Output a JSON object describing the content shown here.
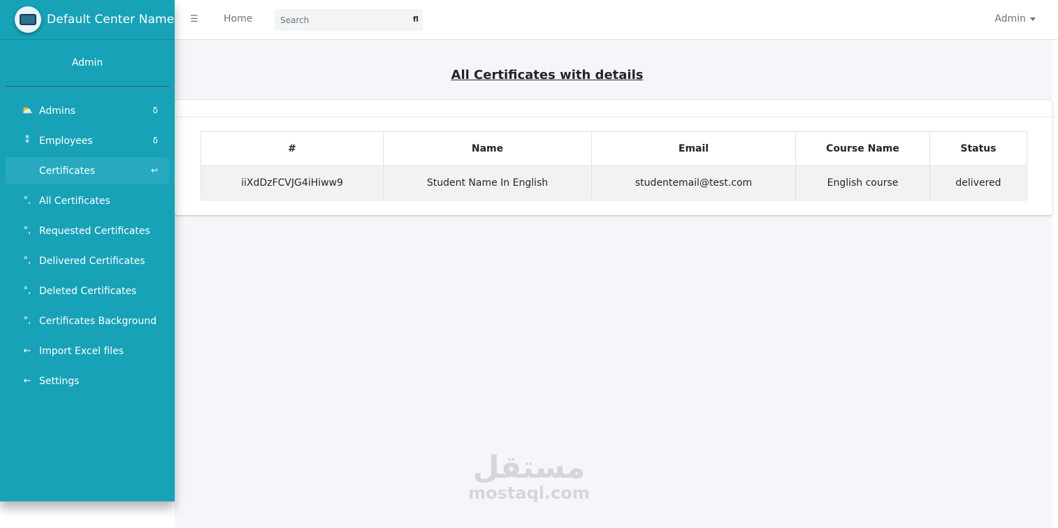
{
  "brand": {
    "name": "Default Center Name"
  },
  "user": {
    "name": "Admin"
  },
  "sidebar": {
    "items": [
      {
        "label": "Admins",
        "icon": "gauge-icon",
        "glyph": "⛅",
        "caret": "δ",
        "active": false
      },
      {
        "label": "Employees",
        "icon": "users-icon",
        "glyph": "⁑",
        "caret": "δ",
        "active": false
      },
      {
        "label": "Certificates",
        "icon": "certificate-icon",
        "glyph": "",
        "caret": "↩",
        "active": true
      },
      {
        "label": "All Certificates",
        "icon": "circle-icon",
        "glyph": "°,",
        "caret": "",
        "active": false
      },
      {
        "label": "Requested Certificates",
        "icon": "circle-icon",
        "glyph": "°,",
        "caret": "",
        "active": false
      },
      {
        "label": "Delivered Certificates",
        "icon": "circle-icon",
        "glyph": "°,",
        "caret": "",
        "active": false
      },
      {
        "label": "Deleted Certificates",
        "icon": "circle-icon",
        "glyph": "°,",
        "caret": "",
        "active": false
      },
      {
        "label": "Certificates Background",
        "icon": "circle-icon",
        "glyph": "°,",
        "caret": "",
        "active": false
      },
      {
        "label": "Import Excel files",
        "icon": "arrow-left-icon",
        "glyph": "←",
        "caret": "",
        "active": false
      },
      {
        "label": "Settings",
        "icon": "arrow-left-icon",
        "glyph": "←",
        "caret": "",
        "active": false
      }
    ]
  },
  "topbar": {
    "menu_glyph": "☰",
    "home_label": "Home",
    "search_placeholder": "Search",
    "search_glyph": "fl",
    "user_menu_label": "Admin"
  },
  "page": {
    "title": "All Certificates with details"
  },
  "table": {
    "headers": [
      "#",
      "Name",
      "Email",
      "Course Name",
      "Status"
    ],
    "rows": [
      [
        "iiXdDzFCVJG4iHiww9",
        "Student Name In English",
        "studentemail@test.com",
        "English course",
        "delivered"
      ]
    ]
  },
  "watermark": {
    "arabic": "مستقل",
    "latin": "mostaql.com"
  }
}
